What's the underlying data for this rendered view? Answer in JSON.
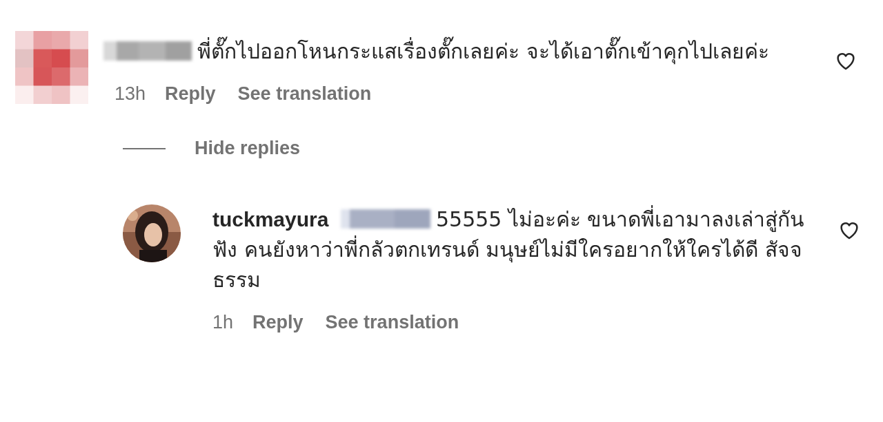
{
  "comments": [
    {
      "username_hidden": true,
      "text": "พี่ตั๊กไปออกโหนกระแสเรื่องตั๊กเลยค่ะ จะได้เอาตั๊กเข้าคุกไปเลยค่ะ",
      "time": "13h",
      "reply_label": "Reply",
      "translate_label": "See translation",
      "liked": false,
      "toggle": {
        "label": "Hide replies"
      },
      "replies": [
        {
          "username": "tuckmayura",
          "mention_hidden": true,
          "text": "55555 ไม่อะค่ะ ขนาดพี่เอามาลงเล่าสู่กันฟัง คนยังหาว่าพี่กลัวตกเทรนด์ มนุษย์ไม่มีใครอยากให้ใครได้ดี สัจจธรรม",
          "time": "1h",
          "reply_label": "Reply",
          "translate_label": "See translation",
          "liked": false
        }
      ]
    }
  ]
}
